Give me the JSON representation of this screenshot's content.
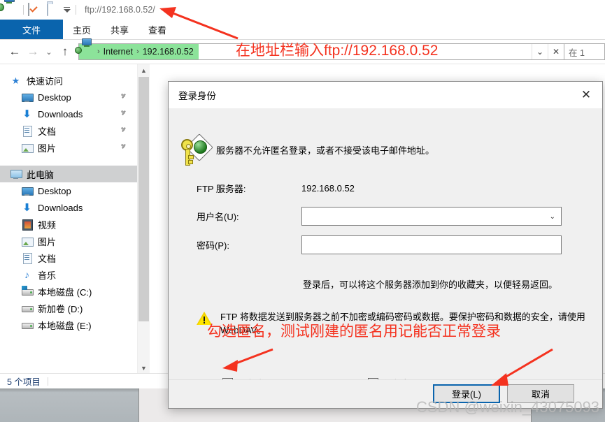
{
  "window": {
    "titlebar": {
      "path_text": "ftp://192.168.0.52/",
      "icons": [
        "network-computer-icon",
        "properties-checkbox-icon",
        "new-folder-icon",
        "customize-quick-access-caret-icon"
      ]
    },
    "ribbon_tabs": [
      {
        "label": "文件",
        "active": true
      },
      {
        "label": "主页",
        "active": false
      },
      {
        "label": "共享",
        "active": false
      },
      {
        "label": "查看",
        "active": false
      }
    ],
    "nav": {
      "back_icon": "back-arrow-icon",
      "forward_icon": "forward-arrow-icon",
      "recent_icon": "recent-locations-caret-icon",
      "up_icon": "up-arrow-icon",
      "breadcrumb": [
        "Internet",
        "192.168.0.52"
      ],
      "breadcrumb_icon": "network-computer-icon",
      "dropdown_icon": "address-dropdown-icon",
      "stop_icon": "stop-refresh-icon",
      "search_text": "在 1"
    },
    "navpane": {
      "quick_access": {
        "label": "快速访问",
        "icon": "star-pin-icon",
        "items": [
          {
            "label": "Desktop",
            "icon": "monitor-icon",
            "pinned": true
          },
          {
            "label": "Downloads",
            "icon": "download-arrow-icon",
            "pinned": true
          },
          {
            "label": "文档",
            "icon": "document-icon",
            "pinned": true
          },
          {
            "label": "图片",
            "icon": "picture-icon",
            "pinned": true
          }
        ]
      },
      "this_pc": {
        "label": "此电脑",
        "icon": "computer-icon",
        "selected": true,
        "items": [
          {
            "label": "Desktop",
            "icon": "monitor-icon"
          },
          {
            "label": "Downloads",
            "icon": "download-arrow-icon"
          },
          {
            "label": "视频",
            "icon": "video-icon"
          },
          {
            "label": "图片",
            "icon": "picture-icon"
          },
          {
            "label": "文档",
            "icon": "document-icon"
          },
          {
            "label": "音乐",
            "icon": "music-note-icon"
          },
          {
            "label": "本地磁盘 (C:)",
            "icon": "system-drive-icon"
          },
          {
            "label": "新加卷 (D:)",
            "icon": "drive-icon"
          },
          {
            "label": "本地磁盘 (E:)",
            "icon": "drive-icon"
          }
        ]
      }
    },
    "statusbar": {
      "item_count": "5 个项目"
    }
  },
  "dialog": {
    "title": "登录身份",
    "close_icon": "close-icon",
    "key_icon": "key-globe-icon",
    "message": "服务器不允许匿名登录，或者不接受该电子邮件地址。",
    "server_label": "FTP 服务器:",
    "server_value": "192.168.0.52",
    "username_label": "用户名(U):",
    "username_value": "",
    "username_dropdown_icon": "chevron-down-icon",
    "password_label": "密码(P):",
    "password_value": "",
    "favorite_note": "登录后，可以将这个服务器添加到你的收藏夹，以便轻易返回。",
    "warning_icon": "warning-triangle-icon",
    "warning_text": "FTP 将数据发送到服务器之前不加密或编码密码或数据。要保护密码和数据的安全，请使用 WebDAV。",
    "anonymous_checkbox": {
      "label": "匿名登录(A)",
      "accel": "A",
      "checked": false
    },
    "save_password_checkbox": {
      "label": "保存密码(S)",
      "accel": "S",
      "checked": false
    },
    "login_button": "登录(L)",
    "cancel_button": "取消"
  },
  "annotations": {
    "address_note": "在地址栏输入ftp://192.168.0.52",
    "anonymous_note": "勾选匿名，测试刚建的匿名用记能否正常登录",
    "arrow_color": "#f4321f"
  },
  "watermark": "CSDN @weixin_43075093",
  "colors": {
    "accent_blue": "#0a64ad",
    "breadcrumb_highlight": "#8ce39a",
    "selection_gray": "#cfd0d1",
    "annotation_red": "#f4321f",
    "dialog_bg": "#f0f0f0"
  }
}
